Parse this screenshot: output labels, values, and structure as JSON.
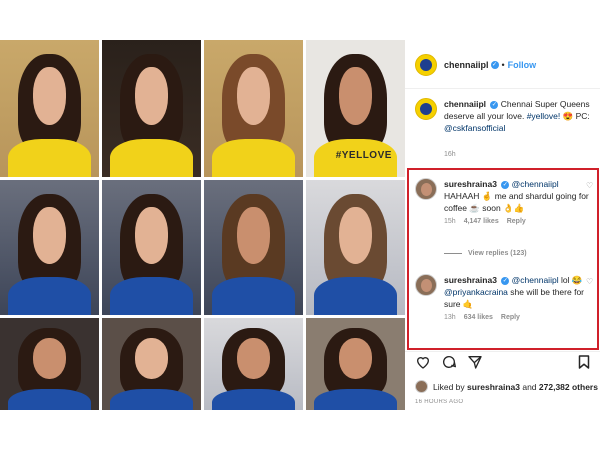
{
  "header": {
    "username": "chennaiipl",
    "separator": "•",
    "follow_label": "Follow"
  },
  "caption": {
    "username": "chennaiipl",
    "text_1": "Chennai Super Queens deserve all your love.",
    "hashtag": "#yellove!",
    "emoji": "😍",
    "text_2": "PC:",
    "mention": "@cskfansofficial",
    "time": "16h"
  },
  "comments": [
    {
      "username": "sureshraina3",
      "mention": "@chennaiipl",
      "text": "HAHAAH 🤞 me and shardul going for coffee ☕ soon 👌👍",
      "time": "15h",
      "likes": "4,147 likes",
      "reply_label": "Reply",
      "view_replies": "View replies (123)"
    },
    {
      "username": "sureshraina3",
      "mention": "@chennaiipl",
      "text_1": "lol",
      "emoji": "😂",
      "mention_2": "@priyankacraina",
      "text_2": "she will be there for sure 🤙",
      "time": "13h",
      "likes": "634 likes",
      "reply_label": "Reply"
    }
  ],
  "likes_bar": {
    "prefix": "Liked by",
    "user": "sureshraina3",
    "middle": "and",
    "count": "272,382 others"
  },
  "post_time": "16 HOURS AGO",
  "icons": [
    "heart-icon",
    "comment-icon",
    "share-icon",
    "bookmark-icon",
    "verified-icon"
  ],
  "grid": {
    "shirt_text": "#YELLOVE",
    "rows": [
      [
        "yellow",
        "yellow",
        "yellow",
        "yellow"
      ],
      [
        "blue",
        "blue",
        "blue",
        "blue"
      ],
      [
        "blue",
        "blue",
        "blue",
        "blue"
      ]
    ]
  },
  "colors": {
    "accent": "#3897f0",
    "highlight": "#d0202a",
    "csk_yellow": "#f5d000",
    "mi_blue": "#1f4fa6"
  }
}
